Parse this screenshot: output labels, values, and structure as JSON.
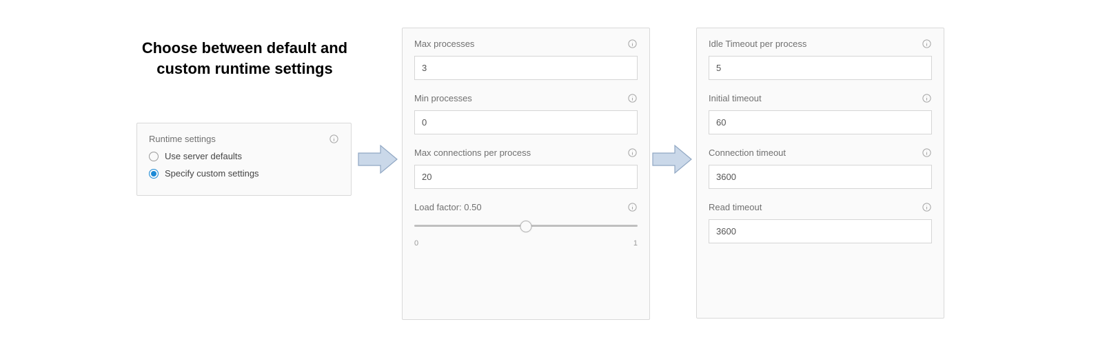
{
  "heading": "Choose between default and custom runtime settings",
  "runtime_card": {
    "title": "Runtime settings",
    "options": [
      {
        "label": "Use server defaults",
        "selected": false
      },
      {
        "label": "Specify custom settings",
        "selected": true
      }
    ]
  },
  "proc_card": {
    "max_processes": {
      "label": "Max processes",
      "value": "3"
    },
    "min_processes": {
      "label": "Min processes",
      "value": "0"
    },
    "max_conn": {
      "label": "Max connections per process",
      "value": "20"
    },
    "load_factor": {
      "label": "Load factor: 0.50",
      "min": "0",
      "max": "1",
      "pos_percent": 50
    }
  },
  "timeout_card": {
    "idle_timeout": {
      "label": "Idle Timeout per process",
      "value": "5"
    },
    "initial": {
      "label": "Initial timeout",
      "value": "60"
    },
    "connection": {
      "label": "Connection timeout",
      "value": "3600"
    },
    "read": {
      "label": "Read timeout",
      "value": "3600"
    }
  },
  "colors": {
    "accent": "#1c8ad6",
    "arrow_fill": "#cad8e9",
    "arrow_stroke": "#90a7c3"
  }
}
